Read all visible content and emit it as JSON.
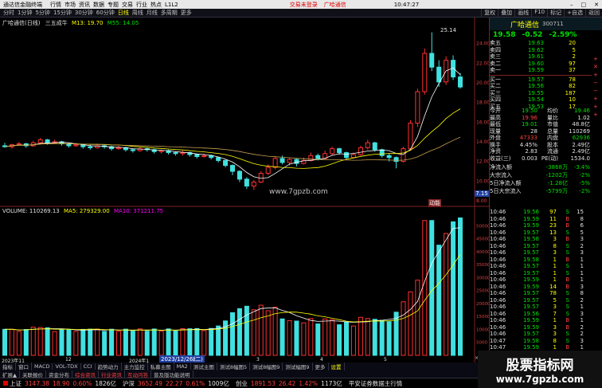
{
  "titlebar": {
    "app": "通达信金融终端",
    "menus": [
      "行情",
      "市场",
      "资讯",
      "数据",
      "专题",
      "交易",
      "行业",
      "热点",
      "L1L2"
    ],
    "alert": "交易未登录",
    "alert2": "广哈通信"
  },
  "toolbar": {
    "periods": [
      "分时",
      "1分钟",
      "5分钟",
      "15分钟",
      "30分钟",
      "60分钟",
      "日线",
      "周线",
      "月线",
      "多周期",
      "更多"
    ],
    "active": "日线",
    "right": [
      "复权",
      "叠加",
      "画线",
      "F10",
      "标记",
      "+自选",
      "返回"
    ]
  },
  "chart": {
    "title": "广哈通信(日线)",
    "mas": "三五成牛",
    "ma13": "M13: 19.70",
    "ma55": "M55: 14.05",
    "high_label": "25.14",
    "watermark": "www.7gpzb.com",
    "price_ticks": [
      "24.00",
      "22.00",
      "20.00",
      "18.00",
      "16.00",
      "14.00",
      "12.00",
      "10.00",
      "8.00"
    ],
    "last_price_tag": "7.15",
    "vol_title": "VOLUME: 110269.13",
    "vol_ma5": "MA5: 279329.00",
    "vol_ma10": "MA10: 371211.75",
    "vol_ticks": [
      "50000",
      "45000",
      "40000",
      "35000",
      "30000",
      "25000",
      "20000",
      "15000",
      "10000",
      "5000"
    ],
    "vol_unit": "×100",
    "date_label": "2023/12/26(二)",
    "x_labels": [
      "2023年11",
      "12",
      "2024年1",
      "2",
      "3",
      "4",
      "5"
    ],
    "hilite_tag": "动能"
  },
  "chart_data": {
    "type": "candlestick",
    "price": [
      [
        13.6,
        13.5,
        13.9,
        13.4
      ],
      [
        13.5,
        13.7,
        13.8,
        13.3
      ],
      [
        13.7,
        13.8,
        14.0,
        13.6
      ],
      [
        13.8,
        13.6,
        13.9,
        13.4
      ],
      [
        13.6,
        13.9,
        14.1,
        13.5
      ],
      [
        13.9,
        14.2,
        14.4,
        13.8
      ],
      [
        14.2,
        13.9,
        14.3,
        13.7
      ],
      [
        13.9,
        14.0,
        14.2,
        13.8
      ],
      [
        14.0,
        13.8,
        14.1,
        13.6
      ],
      [
        13.8,
        13.6,
        13.9,
        13.4
      ],
      [
        13.6,
        13.7,
        13.9,
        13.5
      ],
      [
        13.7,
        13.5,
        13.8,
        13.3
      ],
      [
        13.5,
        13.4,
        13.7,
        13.2
      ],
      [
        13.4,
        13.6,
        13.8,
        13.3
      ],
      [
        13.6,
        13.5,
        13.7,
        13.3
      ],
      [
        13.5,
        13.3,
        13.6,
        13.1
      ],
      [
        13.3,
        13.4,
        13.6,
        13.2
      ],
      [
        13.4,
        13.2,
        13.5,
        13.0
      ],
      [
        13.2,
        13.1,
        13.3,
        12.9
      ],
      [
        13.1,
        13.3,
        13.5,
        13.0
      ],
      [
        13.3,
        13.2,
        13.4,
        13.0
      ],
      [
        13.2,
        13.0,
        13.3,
        12.8
      ],
      [
        13.0,
        13.1,
        13.2,
        12.8
      ],
      [
        13.1,
        12.9,
        13.2,
        12.7
      ],
      [
        12.9,
        12.8,
        13.0,
        12.6
      ],
      [
        12.8,
        12.9,
        13.1,
        12.6
      ],
      [
        12.9,
        12.7,
        13.0,
        12.5
      ],
      [
        12.7,
        12.5,
        12.8,
        12.3
      ],
      [
        12.5,
        12.6,
        12.8,
        12.4
      ],
      [
        12.6,
        12.4,
        12.7,
        12.2
      ],
      [
        12.4,
        12.1,
        12.5,
        11.9
      ],
      [
        12.1,
        11.6,
        12.2,
        11.4
      ],
      [
        11.6,
        11.0,
        11.7,
        10.6
      ],
      [
        11.0,
        10.2,
        11.1,
        9.9
      ],
      [
        10.2,
        9.5,
        10.4,
        9.2
      ],
      [
        9.5,
        9.9,
        10.1,
        9.1
      ],
      [
        9.9,
        10.8,
        11.0,
        9.8
      ],
      [
        10.8,
        11.4,
        11.7,
        10.6
      ],
      [
        11.4,
        12.3,
        12.5,
        11.2
      ],
      [
        12.3,
        11.9,
        12.6,
        11.7
      ],
      [
        11.9,
        12.2,
        12.4,
        11.6
      ],
      [
        12.2,
        11.8,
        12.3,
        11.5
      ],
      [
        11.8,
        12.1,
        12.4,
        11.7
      ],
      [
        12.1,
        12.6,
        12.9,
        12.0
      ],
      [
        12.6,
        12.3,
        12.8,
        12.1
      ],
      [
        12.3,
        12.8,
        13.1,
        12.2
      ],
      [
        12.8,
        13.3,
        13.5,
        12.6
      ],
      [
        13.3,
        12.9,
        13.4,
        12.7
      ],
      [
        12.9,
        12.4,
        13.0,
        12.2
      ],
      [
        12.4,
        12.7,
        12.9,
        12.3
      ],
      [
        12.7,
        13.4,
        13.6,
        12.6
      ],
      [
        13.4,
        13.9,
        14.2,
        13.2
      ],
      [
        13.9,
        13.2,
        14.0,
        13.0
      ],
      [
        13.2,
        12.6,
        13.3,
        12.4
      ],
      [
        12.6,
        12.4,
        12.8,
        12.0
      ],
      [
        12.4,
        12.0,
        12.5,
        11.3
      ],
      [
        12.0,
        13.3,
        13.5,
        11.9
      ],
      [
        13.3,
        15.9,
        16.2,
        13.1
      ],
      [
        15.9,
        19.1,
        19.4,
        15.5
      ],
      [
        19.1,
        23.0,
        23.5,
        18.8
      ],
      [
        23.0,
        21.6,
        25.14,
        21.2
      ],
      [
        21.6,
        20.1,
        22.3,
        19.6
      ],
      [
        20.1,
        22.3,
        22.7,
        19.8
      ],
      [
        22.3,
        20.6,
        22.8,
        20.3
      ],
      [
        20.6,
        19.58,
        21.0,
        19.4
      ]
    ],
    "volume_ma": "MA5 / MA10"
  },
  "right": {
    "name": "广哈通信",
    "code": "300711",
    "price": "19.58",
    "chg": "-0.52",
    "pct": "-2.59%",
    "sells": [
      [
        "卖五",
        "19.63",
        "20"
      ],
      [
        "卖四",
        "19.62",
        "5"
      ],
      [
        "卖三",
        "19.61",
        "2"
      ],
      [
        "卖二",
        "19.60",
        "97"
      ],
      [
        "卖一",
        "19.59",
        "37"
      ]
    ],
    "buys": [
      [
        "买一",
        "19.57",
        "78"
      ],
      [
        "买二",
        "19.56",
        "82"
      ],
      [
        "买三",
        "19.55",
        "187"
      ],
      [
        "买四",
        "19.54",
        "10"
      ],
      [
        "买五",
        "19.53",
        "17"
      ]
    ],
    "stats": [
      [
        "今开",
        "19.50",
        "均价",
        "19.46"
      ],
      [
        "最高",
        "19.96",
        "量比",
        "1.02"
      ],
      [
        "最低",
        "19.01",
        "市值",
        "48.8亿"
      ],
      [
        "现量",
        "28",
        "总量",
        "110269"
      ],
      [
        "外盘",
        "47333",
        "内盘",
        "62936"
      ],
      [
        "换手",
        "4.45%",
        "股本",
        "2.49亿"
      ],
      [
        "净资",
        "2.83",
        "流通",
        "2.49亿"
      ],
      [
        "收益(三)",
        "0.003",
        "PE(动)",
        "1534.0"
      ]
    ],
    "flows": [
      [
        "净流入额",
        "-3868万",
        "-3.4%"
      ],
      [
        "大宗流入",
        "-1202万",
        "-2%"
      ],
      [
        "5日净流入额",
        "-1.28亿",
        "-5%"
      ],
      [
        "5日大宗流入",
        "-5799万",
        "-2%"
      ]
    ],
    "ticks": [
      [
        "10:46",
        "19.56",
        "97",
        "S",
        "15"
      ],
      [
        "10:46",
        "19.59",
        "11",
        "B",
        "8"
      ],
      [
        "10:46",
        "19.59",
        "23",
        "B",
        "6"
      ],
      [
        "10:46",
        "19.57",
        "13",
        "S",
        "5"
      ],
      [
        "10:46",
        "19.58",
        "3",
        "B",
        "3"
      ],
      [
        "10:46",
        "19.57",
        "8",
        "S",
        "2"
      ],
      [
        "10:46",
        "19.57",
        "3",
        "S",
        "3"
      ],
      [
        "10:46",
        "19.58",
        "1",
        "B",
        "1"
      ],
      [
        "10:46",
        "19.57",
        "1",
        "S",
        "1"
      ],
      [
        "10:46",
        "19.57",
        "1",
        "S",
        "1"
      ],
      [
        "10:46",
        "19.59",
        "1",
        "B",
        "1"
      ],
      [
        "10:46",
        "19.59",
        "14",
        "B",
        "3"
      ],
      [
        "10:46",
        "19.57",
        "78",
        "S",
        "8"
      ],
      [
        "10:46",
        "19.57",
        "5",
        "S",
        "2"
      ],
      [
        "10:46",
        "19.57",
        "3",
        "S",
        "1"
      ],
      [
        "10:46",
        "19.56",
        "7",
        "S",
        "3"
      ],
      [
        "10:46",
        "19.59",
        "1",
        "B",
        "1"
      ],
      [
        "10:46",
        "19.59",
        "3",
        "B",
        "2"
      ],
      [
        "10:46",
        "19.57",
        "3",
        "S",
        "2"
      ],
      [
        "10:47",
        "19.58",
        "8",
        "S",
        "3"
      ],
      [
        "10:47",
        "19.59",
        "1",
        "B",
        "1"
      ],
      [
        "10:47",
        "19.59",
        "10",
        "B",
        "3"
      ],
      [
        "10:47",
        "19.57",
        "11",
        "S",
        "4"
      ],
      [
        "10:47",
        "19.58",
        "28",
        "B",
        "5"
      ]
    ]
  },
  "tabs": [
    "指标",
    "窗口",
    "MACD",
    "VOL-TDX",
    "CCI",
    "趋势动力",
    "主力监控",
    "私募主图",
    "MA2",
    "测试主图",
    "测试8幅图5",
    "测试8幅图9",
    "测试幅图9",
    "更多",
    "设置"
  ],
  "tabs2": [
    "扩展▲",
    "关联报价",
    "资金分布",
    "综合资讯",
    "行业资讯",
    "互动问答",
    "普及版功能说明"
  ],
  "status": {
    "sh_name": "上证",
    "sh_val": "3147.38",
    "sh_chg": "18.90",
    "sh_pct": "0.60%",
    "sh_amt": "1826亿",
    "sz_name": "沪深",
    "sz_val": "3652.49",
    "sz_chg": "22.27",
    "sz_pct": "0.61%",
    "sz_amt": "1009亿",
    "cy_name": "创业",
    "cy_val": "1891.53",
    "cy_chg": "26.42",
    "cy_pct": "1.42%",
    "cy_amt": "1173亿",
    "right": "平安证券数据主行情"
  },
  "site": {
    "a": "股票指标网",
    "b": "www.7gpzb.com"
  },
  "clock": "10:47:27"
}
